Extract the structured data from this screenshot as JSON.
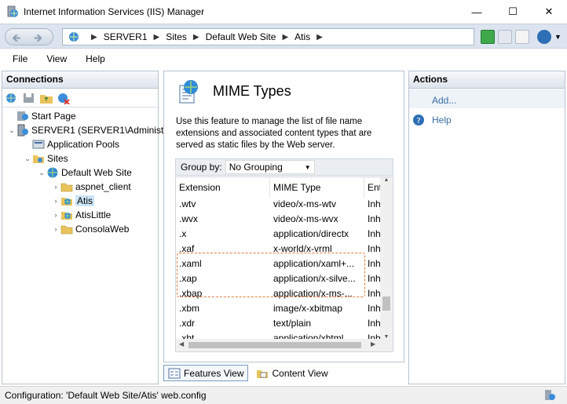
{
  "window": {
    "title": "Internet Information Services (IIS) Manager"
  },
  "address": {
    "crumbs": [
      "SERVER1",
      "Sites",
      "Default Web Site",
      "Atis"
    ]
  },
  "menu": [
    "File",
    "View",
    "Help"
  ],
  "connections": {
    "header": "Connections",
    "tree": [
      {
        "label": "Start Page",
        "level": 0,
        "arrow": "",
        "icon": "start-page-icon"
      },
      {
        "label": "SERVER1 (SERVER1\\Administr",
        "level": 0,
        "arrow": "⌄",
        "icon": "server-icon"
      },
      {
        "label": "Application Pools",
        "level": 1,
        "arrow": "",
        "icon": "app-pools-icon"
      },
      {
        "label": "Sites",
        "level": 1,
        "arrow": "⌄",
        "icon": "sites-icon"
      },
      {
        "label": "Default Web Site",
        "level": 2,
        "arrow": "⌄",
        "icon": "globe-icon"
      },
      {
        "label": "aspnet_client",
        "level": 3,
        "arrow": "›",
        "icon": "folder-icon"
      },
      {
        "label": "Atis",
        "level": 3,
        "arrow": "›",
        "icon": "web-app-icon",
        "selected": true
      },
      {
        "label": "AtisLittle",
        "level": 3,
        "arrow": "›",
        "icon": "web-app-icon"
      },
      {
        "label": "ConsolaWeb",
        "level": 3,
        "arrow": "›",
        "icon": "folder-icon"
      }
    ]
  },
  "feature": {
    "title": "MIME Types",
    "description": "Use this feature to manage the list of file name extensions and associated content types that are served as static files by the Web server.",
    "group_by_label": "Group by:",
    "group_by_value": "No Grouping",
    "columns": [
      "Extension",
      "MIME Type",
      "Ent"
    ],
    "rows": [
      [
        ".wtv",
        "video/x-ms-wtv",
        "Inh"
      ],
      [
        ".wvx",
        "video/x-ms-wvx",
        "Inh"
      ],
      [
        ".x",
        "application/directx",
        "Inh"
      ],
      [
        ".xaf",
        "x-world/x-vrml",
        "Inh"
      ],
      [
        ".xaml",
        "application/xaml+...",
        "Inh"
      ],
      [
        ".xap",
        "application/x-silve...",
        "Inh"
      ],
      [
        ".xbap",
        "application/x-ms-...",
        "Inh"
      ],
      [
        ".xbm",
        "image/x-xbitmap",
        "Inh"
      ],
      [
        ".xdr",
        "text/plain",
        "Inh"
      ],
      [
        ".xht",
        "application/xhtml",
        "Inh"
      ]
    ]
  },
  "view_tabs": {
    "features": "Features View",
    "content": "Content View"
  },
  "actions": {
    "header": "Actions",
    "add": "Add...",
    "help": "Help"
  },
  "status": {
    "text": "Configuration: 'Default Web Site/Atis' web.config"
  }
}
